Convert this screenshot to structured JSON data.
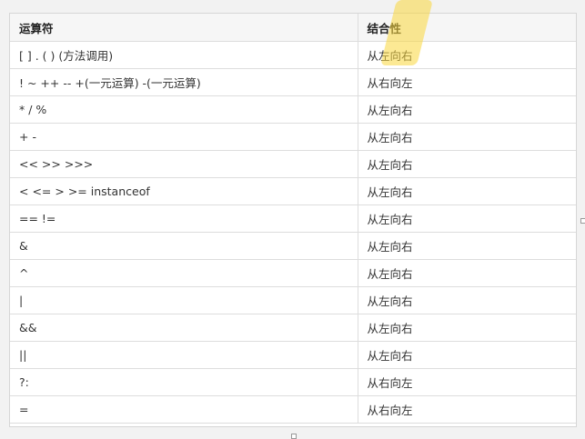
{
  "table": {
    "headers": [
      "运算符",
      "结合性"
    ],
    "rows": [
      [
        "[ ] . ( ) (方法调用)",
        "从左向右"
      ],
      [
        "! ~ ++ -- +(一元运算) -(一元运算)",
        "从右向左"
      ],
      [
        "* / %",
        "从左向右"
      ],
      [
        "+ -",
        "从左向右"
      ],
      [
        "<< >> >>>",
        "从左向右"
      ],
      [
        "< <= > >= instanceof",
        "从左向右"
      ],
      [
        "== !=",
        "从左向右"
      ],
      [
        "&",
        "从左向右"
      ],
      [
        "^",
        "从左向右"
      ],
      [
        "|",
        "从左向右"
      ],
      [
        "&&",
        "从左向右"
      ],
      [
        "||",
        "从左向右"
      ],
      [
        "?:",
        "从右向左"
      ],
      [
        "=",
        "从右向左"
      ]
    ]
  },
  "colors": {
    "highlight": "#fad73c",
    "header_bg": "#f6f6f6",
    "border": "#dddddd"
  }
}
